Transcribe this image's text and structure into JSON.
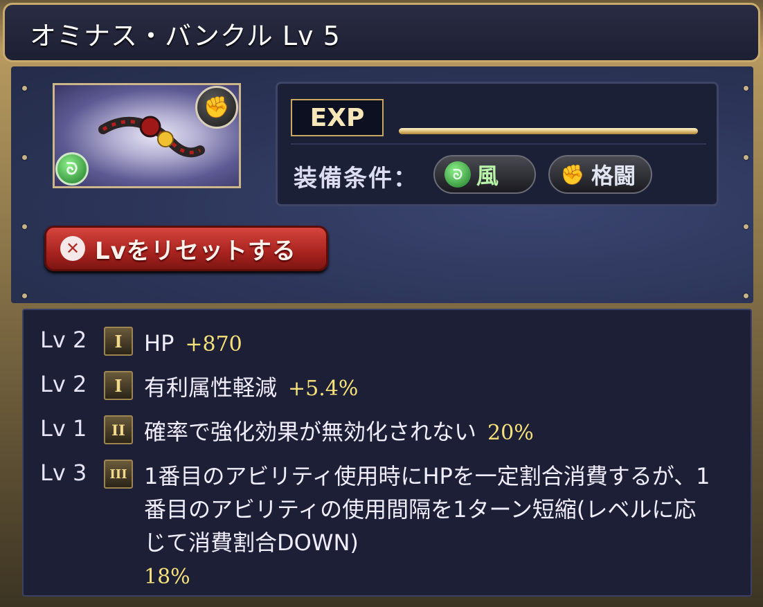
{
  "title": "オミナス・バンクル Lv 5",
  "item": {
    "image_icon": "bangle-item",
    "weapon_type_icon": "fist-icon",
    "element_icon": "wind-icon"
  },
  "exp": {
    "label": "EXP",
    "progress": 1.0
  },
  "equip": {
    "label": "装備条件：",
    "element": "風",
    "weapon_type": "格闘"
  },
  "reset_button": {
    "label": "Lvをリセットする"
  },
  "skills": [
    {
      "level": "Lv 2",
      "rank": "I",
      "name": "HP",
      "value": "+870"
    },
    {
      "level": "Lv 2",
      "rank": "I",
      "name": "有利属性軽減",
      "value": "+5.4%"
    },
    {
      "level": "Lv 1",
      "rank": "II",
      "name": "確率で強化効果が無効化されない",
      "value": "20%"
    },
    {
      "level": "Lv 3",
      "rank": "III",
      "name": "1番目のアビリティ使用時にHPを一定割合消費するが、1番目のアビリティの使用間隔を1ターン短縮(レベルに応じて消費割合DOWN)",
      "value": "18%"
    }
  ],
  "colors": {
    "frame_gold": "#c9ab6d",
    "value_yellow": "#f6e27a",
    "reset_red": "#c0322c",
    "wind_green": "#3cc04a"
  }
}
